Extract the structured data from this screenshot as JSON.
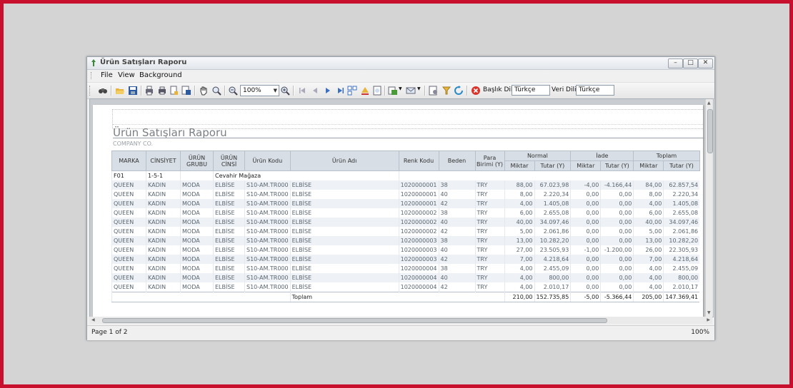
{
  "window": {
    "title": "Ürün Satışları Raporu",
    "controls": {
      "minimize": "–",
      "maximize": "□",
      "close": "✕"
    }
  },
  "menu": {
    "file": "File",
    "view": "View",
    "background": "Background"
  },
  "toolbar": {
    "zoom_value": "100%",
    "baslik_label": "Başlık Dili",
    "baslik_value": "Türkçe",
    "veri_label": "Veri Dili",
    "veri_value": "Türkçe"
  },
  "report": {
    "title": "Ürün Satışları Raporu",
    "company": "COMPANY CO.",
    "headers": {
      "marka": "MARKA",
      "cinsiyet": "CİNSİYET",
      "urun_grubu": "ÜRÜN GRUBU",
      "urun_cinsi": "ÜRÜN CİNSİ",
      "urun_kodu": "Ürün Kodu",
      "urun_adi": "Ürün Adı",
      "renk_kodu": "Renk Kodu",
      "beden": "Beden",
      "para_birimi": "Para Birimi (Y)",
      "normal": "Normal",
      "iade": "İade",
      "toplam": "Toplam",
      "miktar": "Miktar",
      "tutar": "Tutar (Y)"
    },
    "group": {
      "marka": "F01",
      "cinsiyet": "1-5-1",
      "magaza": "Cevahir Mağaza"
    },
    "rows": [
      [
        "QUEEN",
        "KADIN",
        "MODA",
        "ELBİSE",
        "S10-AM.TR000",
        "ELBİSE",
        "1020000001",
        "38",
        "TRY",
        "88,00",
        "67.023,98",
        "-4,00",
        "-4.166,44",
        "84,00",
        "62.857,54"
      ],
      [
        "QUEEN",
        "KADIN",
        "MODA",
        "ELBİSE",
        "S10-AM.TR000",
        "ELBİSE",
        "1020000001",
        "40",
        "TRY",
        "8,00",
        "2.220,34",
        "0,00",
        "0,00",
        "8,00",
        "2.220,34"
      ],
      [
        "QUEEN",
        "KADIN",
        "MODA",
        "ELBİSE",
        "S10-AM.TR000",
        "ELBİSE",
        "1020000001",
        "42",
        "TRY",
        "4,00",
        "1.405,08",
        "0,00",
        "0,00",
        "4,00",
        "1.405,08"
      ],
      [
        "QUEEN",
        "KADIN",
        "MODA",
        "ELBİSE",
        "S10-AM.TR000",
        "ELBİSE",
        "1020000002",
        "38",
        "TRY",
        "6,00",
        "2.655,08",
        "0,00",
        "0,00",
        "6,00",
        "2.655,08"
      ],
      [
        "QUEEN",
        "KADIN",
        "MODA",
        "ELBİSE",
        "S10-AM.TR000",
        "ELBİSE",
        "1020000002",
        "40",
        "TRY",
        "40,00",
        "34.097,46",
        "0,00",
        "0,00",
        "40,00",
        "34.097,46"
      ],
      [
        "QUEEN",
        "KADIN",
        "MODA",
        "ELBİSE",
        "S10-AM.TR000",
        "ELBİSE",
        "1020000002",
        "42",
        "TRY",
        "5,00",
        "2.061,86",
        "0,00",
        "0,00",
        "5,00",
        "2.061,86"
      ],
      [
        "QUEEN",
        "KADIN",
        "MODA",
        "ELBİSE",
        "S10-AM.TR000",
        "ELBİSE",
        "1020000003",
        "38",
        "TRY",
        "13,00",
        "10.282,20",
        "0,00",
        "0,00",
        "13,00",
        "10.282,20"
      ],
      [
        "QUEEN",
        "KADIN",
        "MODA",
        "ELBİSE",
        "S10-AM.TR000",
        "ELBİSE",
        "1020000003",
        "40",
        "TRY",
        "27,00",
        "23.505,93",
        "-1,00",
        "-1.200,00",
        "26,00",
        "22.305,93"
      ],
      [
        "QUEEN",
        "KADIN",
        "MODA",
        "ELBİSE",
        "S10-AM.TR000",
        "ELBİSE",
        "1020000003",
        "42",
        "TRY",
        "7,00",
        "4.218,64",
        "0,00",
        "0,00",
        "7,00",
        "4.218,64"
      ],
      [
        "QUEEN",
        "KADIN",
        "MODA",
        "ELBİSE",
        "S10-AM.TR000",
        "ELBİSE",
        "1020000004",
        "38",
        "TRY",
        "4,00",
        "2.455,09",
        "0,00",
        "0,00",
        "4,00",
        "2.455,09"
      ],
      [
        "QUEEN",
        "KADIN",
        "MODA",
        "ELBİSE",
        "S10-AM.TR000",
        "ELBİSE",
        "1020000004",
        "40",
        "TRY",
        "4,00",
        "800,00",
        "0,00",
        "0,00",
        "4,00",
        "800,00"
      ],
      [
        "QUEEN",
        "KADIN",
        "MODA",
        "ELBİSE",
        "S10-AM.TR000",
        "ELBİSE",
        "1020000004",
        "42",
        "TRY",
        "4,00",
        "2.010,17",
        "0,00",
        "0,00",
        "4,00",
        "2.010,17"
      ]
    ],
    "total": {
      "label": "Toplam",
      "values": [
        "210,00",
        "152.735,85",
        "-5,00",
        "-5.366,44",
        "205,00",
        "147.369,41"
      ]
    }
  },
  "status": {
    "page": "Page 1 of 2",
    "zoom": "100%"
  }
}
